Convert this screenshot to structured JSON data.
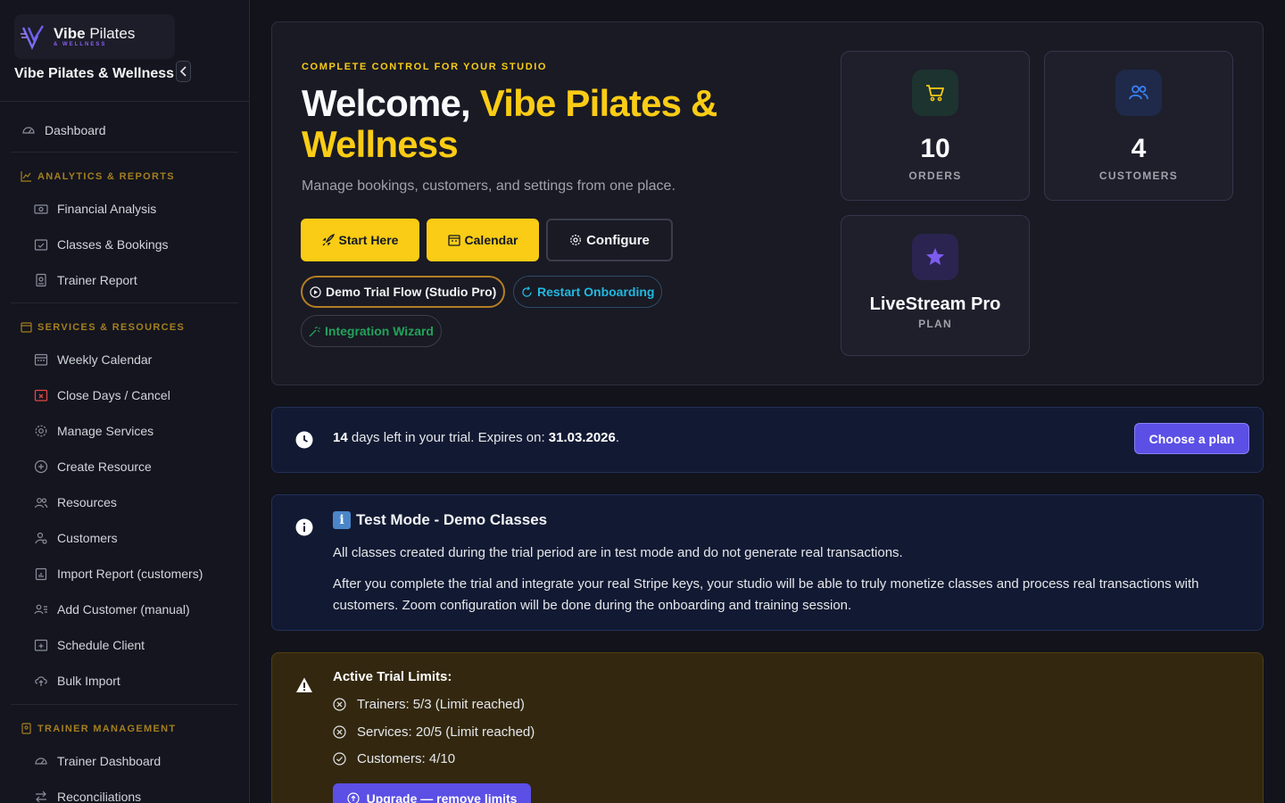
{
  "brand": {
    "name_bold": "Vibe",
    "name_rest": "Pilates",
    "sub": "& WELLNESS",
    "studio": "Vibe Pilates & Wellness"
  },
  "sidebar": {
    "dashboard": "Dashboard",
    "sections": [
      {
        "title": "ANALYTICS & REPORTS",
        "items": [
          "Financial Analysis",
          "Classes & Bookings",
          "Trainer Report"
        ]
      },
      {
        "title": "SERVICES & RESOURCES",
        "items": [
          "Weekly Calendar",
          "Close Days / Cancel",
          "Manage Services",
          "Create Resource",
          "Resources",
          "Customers",
          "Import Report (customers)",
          "Add Customer (manual)",
          "Schedule Client",
          "Bulk Import"
        ]
      },
      {
        "title": "TRAINER MANAGEMENT",
        "items": [
          "Trainer Dashboard",
          "Reconciliations"
        ]
      }
    ]
  },
  "hero": {
    "eyebrow": "COMPLETE CONTROL FOR YOUR STUDIO",
    "welcome": "Welcome, ",
    "studio": "Vibe Pilates & Wellness",
    "subtitle": "Manage bookings, customers, and settings from one place.",
    "buttons": {
      "start": "Start Here",
      "calendar": "Calendar",
      "configure": "Configure"
    },
    "pills": {
      "demo": "Demo Trial Flow (Studio Pro)",
      "restart": "Restart Onboarding",
      "wizard": "Integration Wizard"
    }
  },
  "stats": [
    {
      "value": "10",
      "label": "ORDERS"
    },
    {
      "value": "4",
      "label": "CUSTOMERS"
    },
    {
      "value": "LiveStream Pro",
      "label": "PLAN"
    }
  ],
  "trial": {
    "days": "14",
    "text_mid": " days left in your trial. Expires on: ",
    "date": "31.03.2026",
    "text_end": ".",
    "button": "Choose a plan"
  },
  "test_mode": {
    "title": "Test Mode - Demo Classes",
    "p1": "All classes created during the trial period are in test mode and do not generate real transactions.",
    "p2": "After you complete the trial and integrate your real Stripe keys, your studio will be able to truly monetize classes and process real transactions with customers. Zoom configuration will be done during the onboarding and training session."
  },
  "limits": {
    "title": "Active Trial Limits:",
    "rows": [
      "Trainers: 5/3 (Limit reached)",
      "Services: 20/5 (Limit reached)",
      "Customers: 4/10"
    ],
    "upgrade": "Upgrade — remove limits"
  },
  "colors": {
    "accent_yellow": "#facc15",
    "accent_purple": "#5b4fe6",
    "section_gold": "#a47f1f",
    "green": "#22a35a",
    "cyan": "#22b8e0"
  }
}
